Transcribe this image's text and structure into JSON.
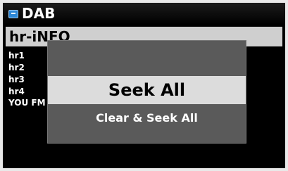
{
  "title_bar": {
    "title": "DAB",
    "icon": "dab-radio-icon"
  },
  "stations": {
    "selected": "hr-iNFO",
    "items": [
      "hr1",
      "hr2",
      "hr3",
      "hr4",
      "YOU FM"
    ]
  },
  "popup": {
    "options": [
      "Seek All",
      "Clear & Seek All"
    ],
    "selected_option": "Seek All"
  },
  "colors": {
    "background": "#000000",
    "highlight": "#d6d6d6",
    "popup": "#5a5a5a",
    "icon_accent": "#2d88d8"
  }
}
